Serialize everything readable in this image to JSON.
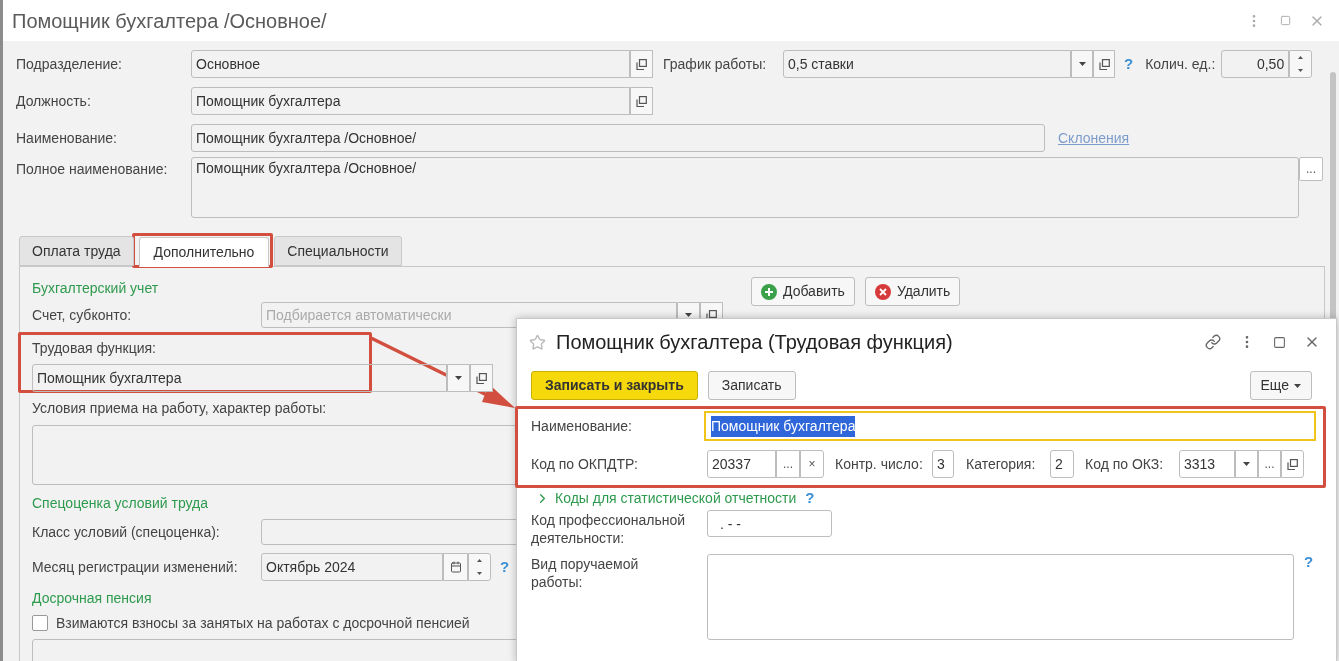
{
  "window": {
    "title": "Помощник бухгалтера /Основное/"
  },
  "form": {
    "subdivision": {
      "label": "Подразделение:",
      "value": "Основное"
    },
    "schedule": {
      "label": "График работы:",
      "value": "0,5 ставки",
      "help": "?"
    },
    "quantity": {
      "label": "Колич. ед.:",
      "value": "0,50"
    },
    "position": {
      "label": "Должность:",
      "value": "Помощник бухгалтера"
    },
    "name": {
      "label": "Наименование:",
      "value": "Помощник бухгалтера /Основное/",
      "link": "Склонения"
    },
    "full_name": {
      "label": "Полное наименование:",
      "value": "Помощник бухгалтера /Основное/",
      "select": "..."
    }
  },
  "tabs": [
    {
      "label": "Оплата труда",
      "selected": false
    },
    {
      "label": "Дополнительно",
      "selected": true
    },
    {
      "label": "Специальности",
      "selected": false
    }
  ],
  "tab_content": {
    "accounting": {
      "heading": "Бухгалтерский учет",
      "account": {
        "label": "Счет, субконто:",
        "placeholder": "Подбирается автоматически"
      },
      "add_button": "Добавить",
      "delete_button": "Удалить"
    },
    "labor_function": {
      "label": "Трудовая функция:",
      "value": "Помощник бухгалтера"
    },
    "conditions": {
      "label": "Условия приема на работу, характер работы:"
    },
    "special_assessment": {
      "heading": "Спецоценка условий труда",
      "class": {
        "label": "Класс условий (спецоценка):"
      },
      "month": {
        "label": "Месяц регистрации изменений:",
        "value": "Октябрь 2024",
        "help": "?"
      }
    },
    "early_pension": {
      "heading": "Досрочная пенсия",
      "checkbox": {
        "label": "Взимаются взносы за занятых на работах с досрочной пенсией",
        "checked": false
      }
    }
  },
  "dialog": {
    "title": "Помощник бухгалтера (Трудовая функция)",
    "buttons": {
      "save_close": "Записать и закрыть",
      "save": "Записать",
      "more": "Еще"
    },
    "name": {
      "label": "Наименование:",
      "value": "Помощник бухгалтера",
      "value_selected": true
    },
    "okpdtr": {
      "label": "Код по ОКПДТР:",
      "value": "20337",
      "select": "...",
      "clear": "×"
    },
    "control_number": {
      "label": "Контр. число:",
      "value": "3"
    },
    "category": {
      "label": "Категория:",
      "value": "2"
    },
    "okz": {
      "label": "Код по ОКЗ:",
      "value": "3313",
      "select": "..."
    },
    "stat_codes": {
      "label": "Коды для статистической отчетности",
      "expanded": false,
      "help": "?"
    },
    "prof_code": {
      "label": "Код профессиональной деятельности:",
      "value": ". - -"
    },
    "work_kind": {
      "label": "Вид поручаемой работы:",
      "help": "?"
    }
  }
}
